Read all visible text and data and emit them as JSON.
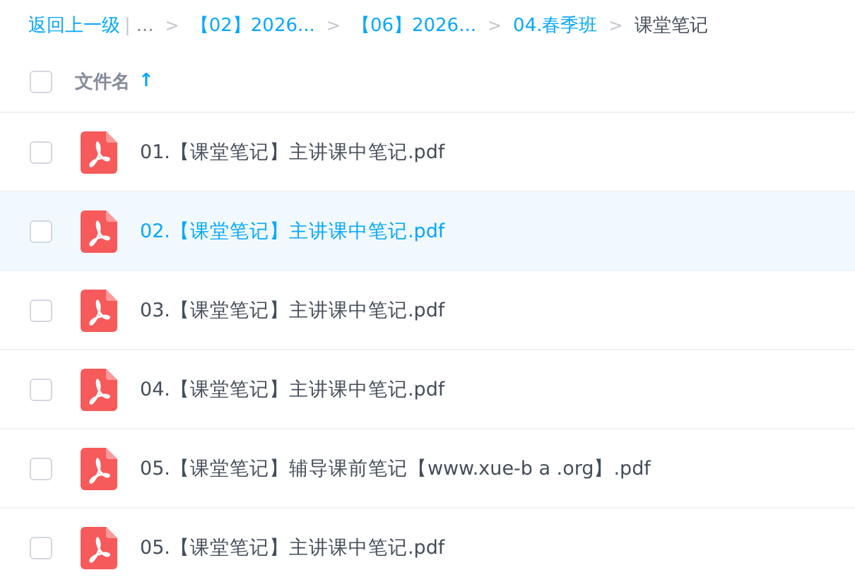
{
  "breadcrumb": {
    "back": "返回上一级",
    "divider": "|",
    "ellipsis": "...",
    "separator": ">",
    "items": [
      {
        "label": "【02】2026...",
        "current": false
      },
      {
        "label": "【06】2026...",
        "current": false
      },
      {
        "label": "04.春季班",
        "current": false
      },
      {
        "label": "课堂笔记",
        "current": true
      }
    ]
  },
  "header": {
    "checked": false,
    "column": "文件名",
    "sort_icon": "↑"
  },
  "files": [
    {
      "name": "01.【课堂笔记】主讲课中笔记.pdf",
      "selected": false,
      "checked": false
    },
    {
      "name": "02.【课堂笔记】主讲课中笔记.pdf",
      "selected": true,
      "checked": false
    },
    {
      "name": "03.【课堂笔记】主讲课中笔记.pdf",
      "selected": false,
      "checked": false
    },
    {
      "name": "04.【课堂笔记】主讲课中笔记.pdf",
      "selected": false,
      "checked": false
    },
    {
      "name": "05.【课堂笔记】辅导课前笔记【www.xue-b a .org】.pdf",
      "selected": false,
      "checked": false
    },
    {
      "name": "05.【课堂笔记】主讲课中笔记.pdf",
      "selected": false,
      "checked": false
    }
  ]
}
